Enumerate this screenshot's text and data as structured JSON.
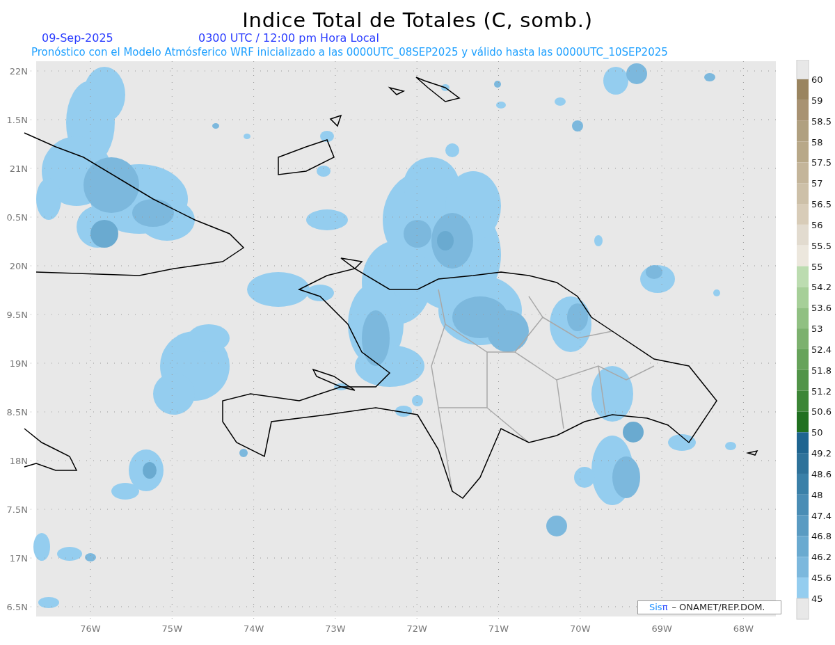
{
  "title": "Indice Total de Totales (C, somb.)",
  "date": "09-Sep-2025",
  "time": "0300 UTC / 12:00 pm Hora Local",
  "subtitle": "Pronóstico con el Modelo Atmósferico WRF inicializado a las 0000UTC_08SEP2025 y válido hasta las  0000UTC_10SEP2025",
  "y_ticks": [
    "22N",
    "1.5N",
    "21N",
    "0.5N",
    "20N",
    "9.5N",
    "19N",
    "8.5N",
    "18N",
    "7.5N",
    "17N",
    "6.5N"
  ],
  "x_ticks": [
    "76W",
    "75W",
    "74W",
    "73W",
    "72W",
    "71W",
    "70W",
    "69W",
    "68W"
  ],
  "legend": {
    "labels": [
      "60",
      "59",
      "58.5",
      "58",
      "57.5",
      "57",
      "56.5",
      "56",
      "55.5",
      "55",
      "54.2",
      "53.6",
      "53",
      "52.4",
      "51.8",
      "51.2",
      "50.6",
      "50",
      "49.2",
      "48.6",
      "48",
      "47.4",
      "46.8",
      "46.2",
      "45.6",
      "45"
    ],
    "bins": [
      {
        "color": "#9a8560"
      },
      {
        "color": "#a89272"
      },
      {
        "color": "#b0a080"
      },
      {
        "color": "#b8a888"
      },
      {
        "color": "#c4b59a"
      },
      {
        "color": "#cdc0a8"
      },
      {
        "color": "#d8ccb8"
      },
      {
        "color": "#e2dbcf"
      },
      {
        "color": "#ece7dd"
      },
      {
        "color": "#bcdcb0"
      },
      {
        "color": "#a6cf98"
      },
      {
        "color": "#90c082"
      },
      {
        "color": "#7cb16e"
      },
      {
        "color": "#66a35a"
      },
      {
        "color": "#519448"
      },
      {
        "color": "#3c8636"
      },
      {
        "color": "#207020"
      },
      {
        "color": "#1f6590"
      },
      {
        "color": "#2e729a"
      },
      {
        "color": "#3a80a8"
      },
      {
        "color": "#4a8db5"
      },
      {
        "color": "#5a9bc2"
      },
      {
        "color": "#6aaad0"
      },
      {
        "color": "#7cb8dd"
      },
      {
        "color": "#94cdef"
      }
    ]
  },
  "credit": {
    "logo_light": "Sis",
    "logo_dark": "π",
    "text": "– ONAMET/REP.DOM."
  }
}
